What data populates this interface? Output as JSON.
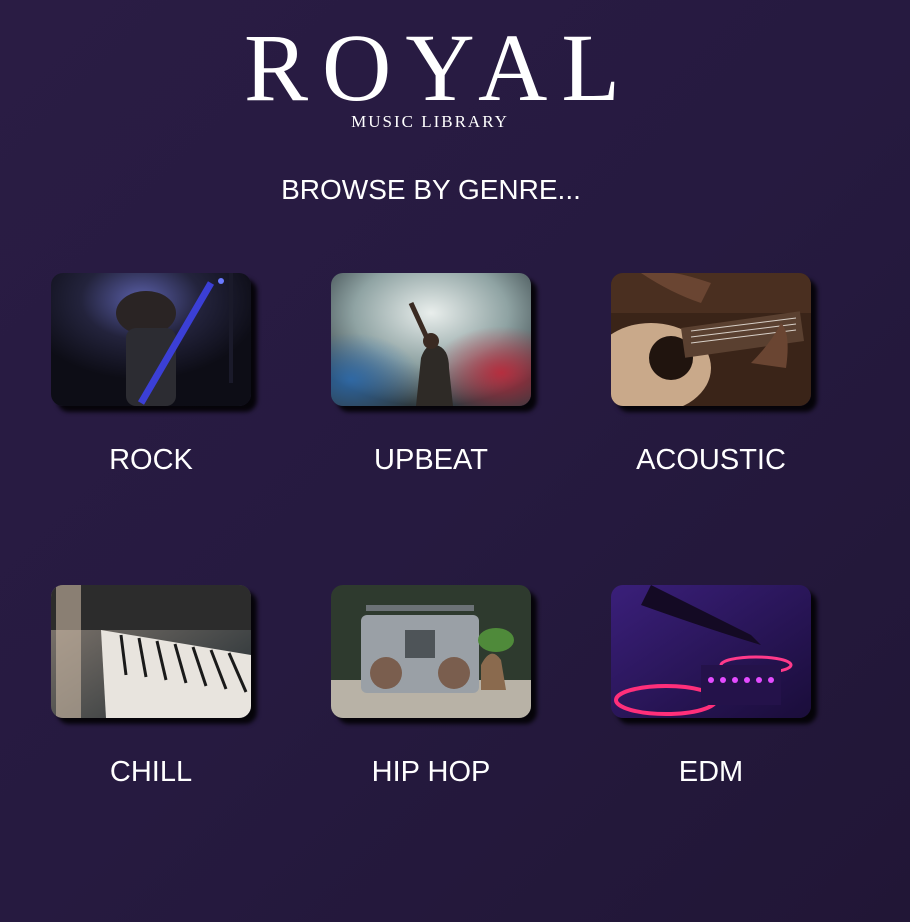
{
  "brand": {
    "name": "ROYAL",
    "tagline": "MUSIC LIBRARY"
  },
  "heading": "BROWSE BY GENRE...",
  "genres": [
    {
      "label": "ROCK",
      "image": "guitarist-on-stage-photo"
    },
    {
      "label": "UPBEAT",
      "image": "singer-with-smoke-photo"
    },
    {
      "label": "ACOUSTIC",
      "image": "acoustic-guitar-photo"
    },
    {
      "label": "CHILL",
      "image": "piano-keys-photo"
    },
    {
      "label": "HIP HOP",
      "image": "boombox-photo"
    },
    {
      "label": "EDM",
      "image": "dj-turntable-photo"
    }
  ]
}
